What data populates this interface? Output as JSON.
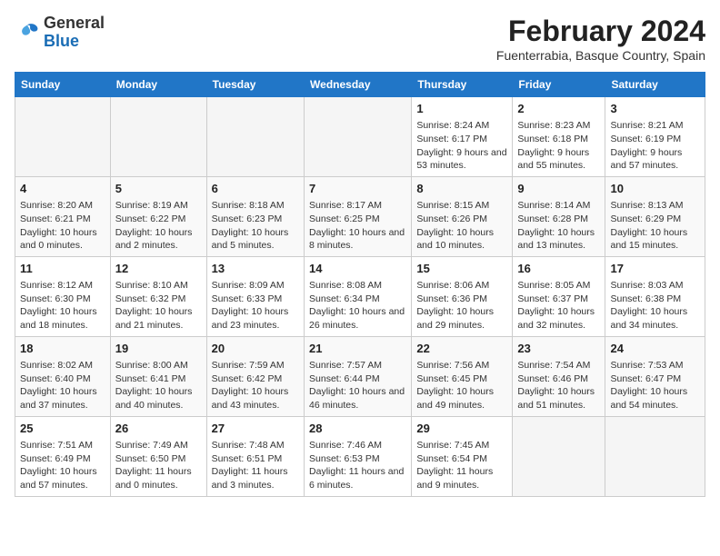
{
  "header": {
    "logo_general": "General",
    "logo_blue": "Blue",
    "title": "February 2024",
    "subtitle": "Fuenterrabia, Basque Country, Spain"
  },
  "columns": [
    "Sunday",
    "Monday",
    "Tuesday",
    "Wednesday",
    "Thursday",
    "Friday",
    "Saturday"
  ],
  "weeks": [
    [
      {
        "day": "",
        "info": ""
      },
      {
        "day": "",
        "info": ""
      },
      {
        "day": "",
        "info": ""
      },
      {
        "day": "",
        "info": ""
      },
      {
        "day": "1",
        "info": "Sunrise: 8:24 AM\nSunset: 6:17 PM\nDaylight: 9 hours and 53 minutes."
      },
      {
        "day": "2",
        "info": "Sunrise: 8:23 AM\nSunset: 6:18 PM\nDaylight: 9 hours and 55 minutes."
      },
      {
        "day": "3",
        "info": "Sunrise: 8:21 AM\nSunset: 6:19 PM\nDaylight: 9 hours and 57 minutes."
      }
    ],
    [
      {
        "day": "4",
        "info": "Sunrise: 8:20 AM\nSunset: 6:21 PM\nDaylight: 10 hours and 0 minutes."
      },
      {
        "day": "5",
        "info": "Sunrise: 8:19 AM\nSunset: 6:22 PM\nDaylight: 10 hours and 2 minutes."
      },
      {
        "day": "6",
        "info": "Sunrise: 8:18 AM\nSunset: 6:23 PM\nDaylight: 10 hours and 5 minutes."
      },
      {
        "day": "7",
        "info": "Sunrise: 8:17 AM\nSunset: 6:25 PM\nDaylight: 10 hours and 8 minutes."
      },
      {
        "day": "8",
        "info": "Sunrise: 8:15 AM\nSunset: 6:26 PM\nDaylight: 10 hours and 10 minutes."
      },
      {
        "day": "9",
        "info": "Sunrise: 8:14 AM\nSunset: 6:28 PM\nDaylight: 10 hours and 13 minutes."
      },
      {
        "day": "10",
        "info": "Sunrise: 8:13 AM\nSunset: 6:29 PM\nDaylight: 10 hours and 15 minutes."
      }
    ],
    [
      {
        "day": "11",
        "info": "Sunrise: 8:12 AM\nSunset: 6:30 PM\nDaylight: 10 hours and 18 minutes."
      },
      {
        "day": "12",
        "info": "Sunrise: 8:10 AM\nSunset: 6:32 PM\nDaylight: 10 hours and 21 minutes."
      },
      {
        "day": "13",
        "info": "Sunrise: 8:09 AM\nSunset: 6:33 PM\nDaylight: 10 hours and 23 minutes."
      },
      {
        "day": "14",
        "info": "Sunrise: 8:08 AM\nSunset: 6:34 PM\nDaylight: 10 hours and 26 minutes."
      },
      {
        "day": "15",
        "info": "Sunrise: 8:06 AM\nSunset: 6:36 PM\nDaylight: 10 hours and 29 minutes."
      },
      {
        "day": "16",
        "info": "Sunrise: 8:05 AM\nSunset: 6:37 PM\nDaylight: 10 hours and 32 minutes."
      },
      {
        "day": "17",
        "info": "Sunrise: 8:03 AM\nSunset: 6:38 PM\nDaylight: 10 hours and 34 minutes."
      }
    ],
    [
      {
        "day": "18",
        "info": "Sunrise: 8:02 AM\nSunset: 6:40 PM\nDaylight: 10 hours and 37 minutes."
      },
      {
        "day": "19",
        "info": "Sunrise: 8:00 AM\nSunset: 6:41 PM\nDaylight: 10 hours and 40 minutes."
      },
      {
        "day": "20",
        "info": "Sunrise: 7:59 AM\nSunset: 6:42 PM\nDaylight: 10 hours and 43 minutes."
      },
      {
        "day": "21",
        "info": "Sunrise: 7:57 AM\nSunset: 6:44 PM\nDaylight: 10 hours and 46 minutes."
      },
      {
        "day": "22",
        "info": "Sunrise: 7:56 AM\nSunset: 6:45 PM\nDaylight: 10 hours and 49 minutes."
      },
      {
        "day": "23",
        "info": "Sunrise: 7:54 AM\nSunset: 6:46 PM\nDaylight: 10 hours and 51 minutes."
      },
      {
        "day": "24",
        "info": "Sunrise: 7:53 AM\nSunset: 6:47 PM\nDaylight: 10 hours and 54 minutes."
      }
    ],
    [
      {
        "day": "25",
        "info": "Sunrise: 7:51 AM\nSunset: 6:49 PM\nDaylight: 10 hours and 57 minutes."
      },
      {
        "day": "26",
        "info": "Sunrise: 7:49 AM\nSunset: 6:50 PM\nDaylight: 11 hours and 0 minutes."
      },
      {
        "day": "27",
        "info": "Sunrise: 7:48 AM\nSunset: 6:51 PM\nDaylight: 11 hours and 3 minutes."
      },
      {
        "day": "28",
        "info": "Sunrise: 7:46 AM\nSunset: 6:53 PM\nDaylight: 11 hours and 6 minutes."
      },
      {
        "day": "29",
        "info": "Sunrise: 7:45 AM\nSunset: 6:54 PM\nDaylight: 11 hours and 9 minutes."
      },
      {
        "day": "",
        "info": ""
      },
      {
        "day": "",
        "info": ""
      }
    ]
  ]
}
